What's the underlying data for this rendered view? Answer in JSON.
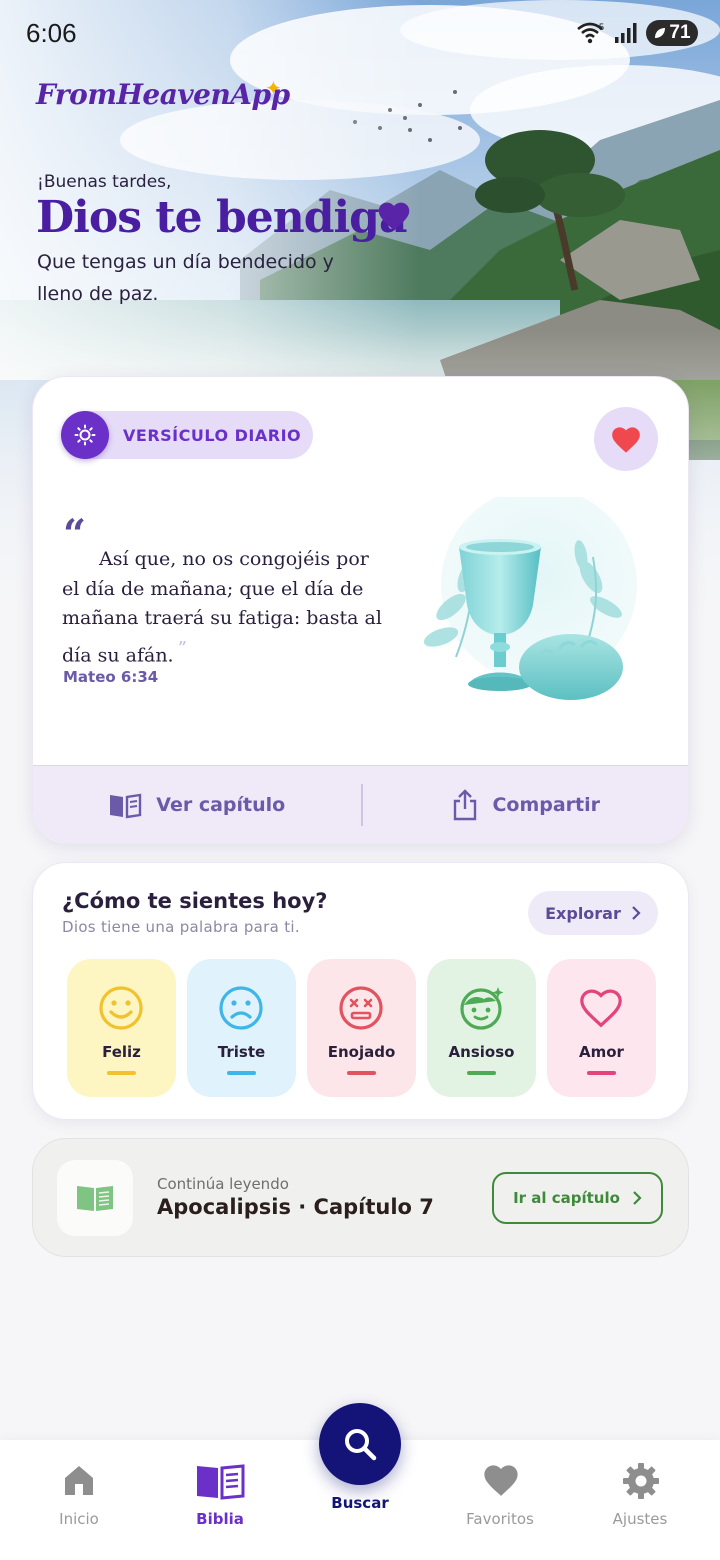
{
  "status_bar": {
    "time": "6:06",
    "network_badge": "5",
    "battery": "71"
  },
  "app": {
    "logo": "FromHeavenApp"
  },
  "greeting": {
    "small": "¡Buenas tardes,",
    "big": "Dios te bendiga",
    "sub": "Que tengas un día bendecido y lleno de paz."
  },
  "verse": {
    "badge": "VERSÍCULO DIARIO",
    "text": "Así que, no os congojéis por el día de mañana; que el día de mañana traerá su fatiga: basta al día su afán.",
    "reference": "Mateo 6:34",
    "actions": {
      "chapter": "Ver capítulo",
      "share": "Compartir"
    }
  },
  "mood": {
    "title": "¿Cómo te sientes hoy?",
    "subtitle": "Dios tiene una palabra para ti.",
    "explore": "Explorar",
    "items": [
      {
        "label": "Feliz",
        "icon": "happy-face-icon",
        "bg": "#fdf6c3",
        "color": "#f2c12e"
      },
      {
        "label": "Triste",
        "icon": "sad-face-icon",
        "bg": "#e0f2fb",
        "color": "#3fb6e8"
      },
      {
        "label": "Enojado",
        "icon": "angry-face-icon",
        "bg": "#fde6ea",
        "color": "#e2525f"
      },
      {
        "label": "Ansioso",
        "icon": "anxious-face-icon",
        "bg": "#e3f3e3",
        "color": "#4faa55"
      },
      {
        "label": "Amor",
        "icon": "heart-icon",
        "bg": "#fde6ee",
        "color": "#e2457c"
      }
    ]
  },
  "continue_reading": {
    "label": "Continúa leyendo",
    "title": "Apocalipsis · Capítulo 7",
    "button": "Ir al capítulo"
  },
  "nav": {
    "items": [
      {
        "label": "Inicio",
        "icon": "home-icon",
        "active": false
      },
      {
        "label": "Biblia",
        "icon": "book-icon",
        "active": true
      },
      {
        "label": "Buscar",
        "icon": "search-icon",
        "active": false
      },
      {
        "label": "Favoritos",
        "icon": "heart-icon",
        "active": false
      },
      {
        "label": "Ajustes",
        "icon": "gear-icon",
        "active": false
      }
    ]
  },
  "colors": {
    "primary": "#5a24a8",
    "accent_purple": "#6a30c8",
    "fab": "#141478",
    "heart": "#f0484f",
    "green": "#3f8a3a"
  }
}
